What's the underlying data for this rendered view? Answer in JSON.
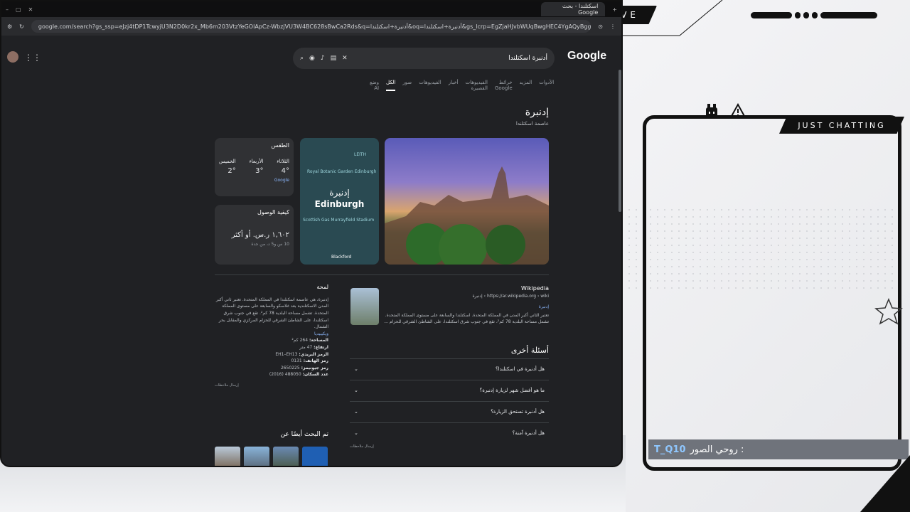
{
  "overlay": {
    "live_label": "LIVE",
    "chat_label": "JUST CHATTING",
    "username_prefix": "روحي الصور :",
    "username": "T_Q10"
  },
  "browser": {
    "tab_title": "اسكتلندا - بحث Google",
    "url": "google.com/search?gs_ssp=eJzj4tDP1TcwyjU3N2D0kr2x_Mb6m203VtzYeGOlApCz-WbzjVU3W4BC628sBwCa2Rds&q=أدنبرة+اسكتلندا&oq=أدنبرة+اسكتلندا&gs_lcrp=EgZjaHJvbWUqBwgHEC4YgAQyBggAEEUYOTIHCAEQABiABDIHCAIQABiABDIHCA...",
    "logo": "Google",
    "search_query": "أدنبرة اسكتلندا",
    "nav_tabs": [
      "وضع AI",
      "الكل",
      "صور",
      "الفيديوهات",
      "أخبار",
      "الفيديوهات القصيرة",
      "خرائط Google",
      "المزيد",
      "الأدوات"
    ],
    "active_tab": "الكل"
  },
  "entity": {
    "title": "إدنبرة",
    "subtitle": "عاصمة اسكتلندا"
  },
  "map": {
    "city_ar": "إدنبرة",
    "city_en": "Edinburgh",
    "labels": [
      "Royal Botanic Garden Edinburgh",
      "LEITH",
      "Scottish Gas Murrayfield Stadium",
      "Blackford"
    ]
  },
  "weather": {
    "title": "الطقس",
    "days": [
      {
        "name": "الثلاثاء",
        "temp": "4°"
      },
      {
        "name": "الأربعاء",
        "temp": "3°"
      },
      {
        "name": "الخميس",
        "temp": "2°"
      }
    ],
    "source": "Google"
  },
  "howto": {
    "title": "كيفية الوصول",
    "price": "١,٦٠٢ ر.س. أو أكثر",
    "detail": "10 س و5 د، من جدة"
  },
  "wikipedia": {
    "source": "Wikipedia",
    "url": "https://ar.wikipedia.org › wiki › إدنبرة",
    "link": "إدنبرة",
    "snippet": "تعتبر الثاني أكبر المدن في المملكة المتحدة. اسكتلندا والسابعة على مستوى المملكة المتحدة. تشمل مساحة البلدية 78 كم²، تقع في جنوب شرق اسكتلندا، على الشاطئ الشرقي للحزام ..."
  },
  "faq": {
    "title": "أسئلة أخرى",
    "items": [
      "هل أدنبرة في اسكتلندا؟",
      "ما هو أفضل شهر لزيارة إدنبرة؟",
      "هل أدنبرة تستحق الزيارة؟",
      "هل أدنبرة آمنة؟"
    ],
    "feedback": "إرسال ملاحظات"
  },
  "info": {
    "heading": "لمحة",
    "text": "إدنبرة، هي عاصمة اسكتلندا في المملكة المتحدة. تعتبر ثاني أكبر المدن الاسكتلندية بعد غلاسكو والسابعة على مستوى المملكة المتحدة. تشمل مساحة البلدية 78 كم². تقع في جنوب شرق اسكتلندا، على الشاطئ الشرقي للحزام المركزي والمقابل بحر الشمال.",
    "wiki_link": "ويكيبيديا",
    "area_label": "المساحة:",
    "area": "264 كم²",
    "elevation_label": "ارتفاع:",
    "elevation": "47 متر",
    "postcode_label": "الرمز البريدي:",
    "postcode": "EH1–EH13",
    "phone_label": "رمز الهاتف:",
    "phone": "0131",
    "geonames_label": "رمز جيونيمز:",
    "geonames": "2650225",
    "population_label": "عدد السكان:",
    "population": "488050 (2016)",
    "feedback": "إرسال ملاحظات"
  },
  "people_also_search": {
    "title": "تم البحث أيضًا عن"
  }
}
